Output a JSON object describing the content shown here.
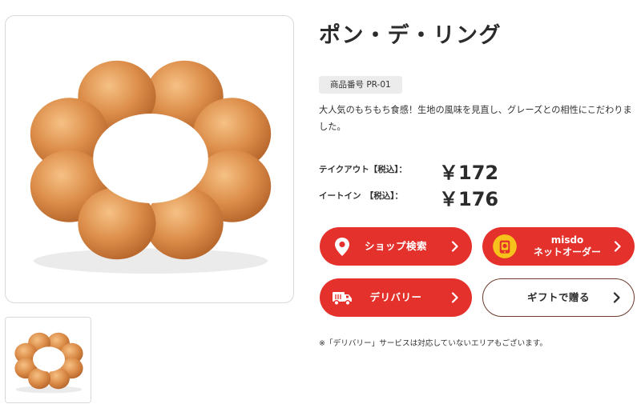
{
  "product": {
    "title": "ポン・デ・リング",
    "code": "商品番号 PR-01",
    "description": "大人気のもちもち食感！生地の風味を見直し、グレーズとの相性にこだわりました。"
  },
  "prices": {
    "takeout_label": "テイクアウト【税込】：",
    "takeout_value": "￥172",
    "eatin_label": "イートイン　【税込】：",
    "eatin_value": "￥176"
  },
  "buttons": {
    "shop_search": "ショップ検索",
    "misdo_line1": "misdo",
    "misdo_line2": "ネットオーダー",
    "delivery": "デリバリー",
    "gift": "ギフトで贈る"
  },
  "note": "※「デリバリー」サービスは対応していないエリアもございます。",
  "colors": {
    "accent_red": "#e4312b",
    "outline_brown": "#6a3a2f",
    "donut_base": "#d88a46",
    "donut_highlight": "#f3b878"
  },
  "icons": {
    "shop": "location-pin-icon",
    "order": "misdo-order-icon",
    "delivery": "delivery-truck-icon",
    "chevron": "chevron-right-icon"
  }
}
